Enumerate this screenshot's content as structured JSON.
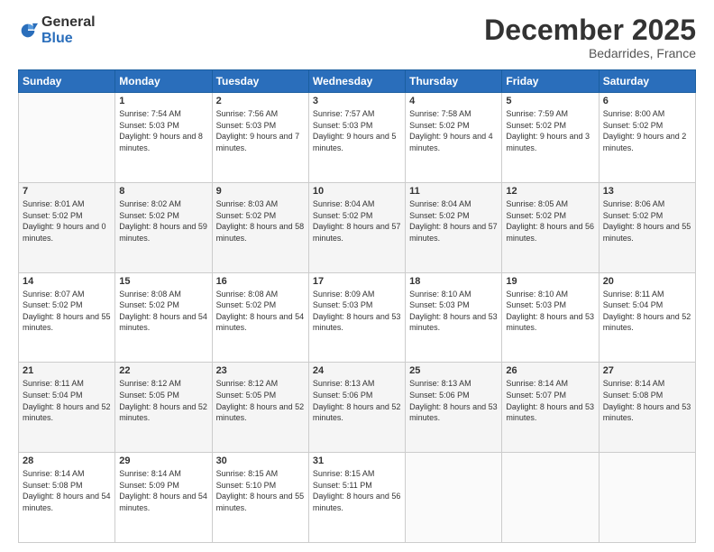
{
  "logo": {
    "line1": "General",
    "line2": "Blue"
  },
  "title": "December 2025",
  "location": "Bedarrides, France",
  "header": {
    "days": [
      "Sunday",
      "Monday",
      "Tuesday",
      "Wednesday",
      "Thursday",
      "Friday",
      "Saturday"
    ]
  },
  "weeks": [
    [
      {
        "day": "",
        "sunrise": "",
        "sunset": "",
        "daylight": ""
      },
      {
        "day": "1",
        "sunrise": "Sunrise: 7:54 AM",
        "sunset": "Sunset: 5:03 PM",
        "daylight": "Daylight: 9 hours and 8 minutes."
      },
      {
        "day": "2",
        "sunrise": "Sunrise: 7:56 AM",
        "sunset": "Sunset: 5:03 PM",
        "daylight": "Daylight: 9 hours and 7 minutes."
      },
      {
        "day": "3",
        "sunrise": "Sunrise: 7:57 AM",
        "sunset": "Sunset: 5:03 PM",
        "daylight": "Daylight: 9 hours and 5 minutes."
      },
      {
        "day": "4",
        "sunrise": "Sunrise: 7:58 AM",
        "sunset": "Sunset: 5:02 PM",
        "daylight": "Daylight: 9 hours and 4 minutes."
      },
      {
        "day": "5",
        "sunrise": "Sunrise: 7:59 AM",
        "sunset": "Sunset: 5:02 PM",
        "daylight": "Daylight: 9 hours and 3 minutes."
      },
      {
        "day": "6",
        "sunrise": "Sunrise: 8:00 AM",
        "sunset": "Sunset: 5:02 PM",
        "daylight": "Daylight: 9 hours and 2 minutes."
      }
    ],
    [
      {
        "day": "7",
        "sunrise": "Sunrise: 8:01 AM",
        "sunset": "Sunset: 5:02 PM",
        "daylight": "Daylight: 9 hours and 0 minutes."
      },
      {
        "day": "8",
        "sunrise": "Sunrise: 8:02 AM",
        "sunset": "Sunset: 5:02 PM",
        "daylight": "Daylight: 8 hours and 59 minutes."
      },
      {
        "day": "9",
        "sunrise": "Sunrise: 8:03 AM",
        "sunset": "Sunset: 5:02 PM",
        "daylight": "Daylight: 8 hours and 58 minutes."
      },
      {
        "day": "10",
        "sunrise": "Sunrise: 8:04 AM",
        "sunset": "Sunset: 5:02 PM",
        "daylight": "Daylight: 8 hours and 57 minutes."
      },
      {
        "day": "11",
        "sunrise": "Sunrise: 8:04 AM",
        "sunset": "Sunset: 5:02 PM",
        "daylight": "Daylight: 8 hours and 57 minutes."
      },
      {
        "day": "12",
        "sunrise": "Sunrise: 8:05 AM",
        "sunset": "Sunset: 5:02 PM",
        "daylight": "Daylight: 8 hours and 56 minutes."
      },
      {
        "day": "13",
        "sunrise": "Sunrise: 8:06 AM",
        "sunset": "Sunset: 5:02 PM",
        "daylight": "Daylight: 8 hours and 55 minutes."
      }
    ],
    [
      {
        "day": "14",
        "sunrise": "Sunrise: 8:07 AM",
        "sunset": "Sunset: 5:02 PM",
        "daylight": "Daylight: 8 hours and 55 minutes."
      },
      {
        "day": "15",
        "sunrise": "Sunrise: 8:08 AM",
        "sunset": "Sunset: 5:02 PM",
        "daylight": "Daylight: 8 hours and 54 minutes."
      },
      {
        "day": "16",
        "sunrise": "Sunrise: 8:08 AM",
        "sunset": "Sunset: 5:02 PM",
        "daylight": "Daylight: 8 hours and 54 minutes."
      },
      {
        "day": "17",
        "sunrise": "Sunrise: 8:09 AM",
        "sunset": "Sunset: 5:03 PM",
        "daylight": "Daylight: 8 hours and 53 minutes."
      },
      {
        "day": "18",
        "sunrise": "Sunrise: 8:10 AM",
        "sunset": "Sunset: 5:03 PM",
        "daylight": "Daylight: 8 hours and 53 minutes."
      },
      {
        "day": "19",
        "sunrise": "Sunrise: 8:10 AM",
        "sunset": "Sunset: 5:03 PM",
        "daylight": "Daylight: 8 hours and 53 minutes."
      },
      {
        "day": "20",
        "sunrise": "Sunrise: 8:11 AM",
        "sunset": "Sunset: 5:04 PM",
        "daylight": "Daylight: 8 hours and 52 minutes."
      }
    ],
    [
      {
        "day": "21",
        "sunrise": "Sunrise: 8:11 AM",
        "sunset": "Sunset: 5:04 PM",
        "daylight": "Daylight: 8 hours and 52 minutes."
      },
      {
        "day": "22",
        "sunrise": "Sunrise: 8:12 AM",
        "sunset": "Sunset: 5:05 PM",
        "daylight": "Daylight: 8 hours and 52 minutes."
      },
      {
        "day": "23",
        "sunrise": "Sunrise: 8:12 AM",
        "sunset": "Sunset: 5:05 PM",
        "daylight": "Daylight: 8 hours and 52 minutes."
      },
      {
        "day": "24",
        "sunrise": "Sunrise: 8:13 AM",
        "sunset": "Sunset: 5:06 PM",
        "daylight": "Daylight: 8 hours and 52 minutes."
      },
      {
        "day": "25",
        "sunrise": "Sunrise: 8:13 AM",
        "sunset": "Sunset: 5:06 PM",
        "daylight": "Daylight: 8 hours and 53 minutes."
      },
      {
        "day": "26",
        "sunrise": "Sunrise: 8:14 AM",
        "sunset": "Sunset: 5:07 PM",
        "daylight": "Daylight: 8 hours and 53 minutes."
      },
      {
        "day": "27",
        "sunrise": "Sunrise: 8:14 AM",
        "sunset": "Sunset: 5:08 PM",
        "daylight": "Daylight: 8 hours and 53 minutes."
      }
    ],
    [
      {
        "day": "28",
        "sunrise": "Sunrise: 8:14 AM",
        "sunset": "Sunset: 5:08 PM",
        "daylight": "Daylight: 8 hours and 54 minutes."
      },
      {
        "day": "29",
        "sunrise": "Sunrise: 8:14 AM",
        "sunset": "Sunset: 5:09 PM",
        "daylight": "Daylight: 8 hours and 54 minutes."
      },
      {
        "day": "30",
        "sunrise": "Sunrise: 8:15 AM",
        "sunset": "Sunset: 5:10 PM",
        "daylight": "Daylight: 8 hours and 55 minutes."
      },
      {
        "day": "31",
        "sunrise": "Sunrise: 8:15 AM",
        "sunset": "Sunset: 5:11 PM",
        "daylight": "Daylight: 8 hours and 56 minutes."
      },
      {
        "day": "",
        "sunrise": "",
        "sunset": "",
        "daylight": ""
      },
      {
        "day": "",
        "sunrise": "",
        "sunset": "",
        "daylight": ""
      },
      {
        "day": "",
        "sunrise": "",
        "sunset": "",
        "daylight": ""
      }
    ]
  ]
}
